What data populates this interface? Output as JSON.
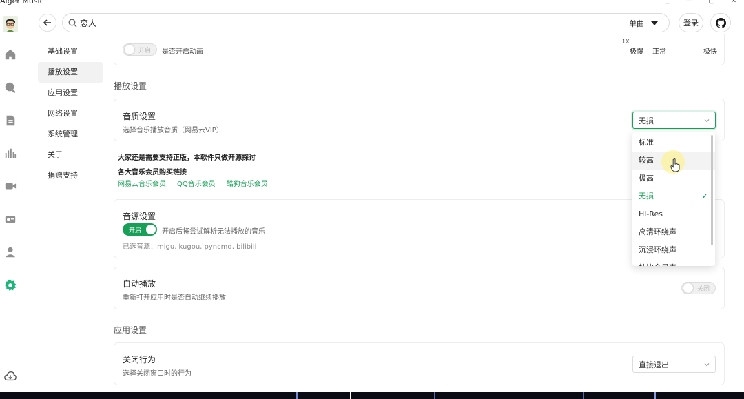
{
  "window": {
    "title": "Aiger Music",
    "controls": [
      "▢",
      "—",
      "▢",
      "✕"
    ]
  },
  "header": {
    "search_value": "恋人",
    "search_type": "单曲",
    "login_label": "登录"
  },
  "rail": {
    "items": [
      "home-icon",
      "search-icon",
      "playlist-icon",
      "chart-icon",
      "video-icon",
      "radio-icon",
      "user-icon",
      "settings-icon",
      "cloud-download-icon"
    ],
    "active": "settings-icon",
    "accent": "#1bb57a"
  },
  "settings_nav": {
    "items": [
      "基础设置",
      "播放设置",
      "应用设置",
      "网络设置",
      "系统管理",
      "关于",
      "捐赠支持"
    ],
    "active_index": 1
  },
  "animation": {
    "toggle_label": "开启",
    "desc": "是否开启动画",
    "speed_tick": "1X",
    "speed_labels": [
      "极慢",
      "正常",
      "极快"
    ]
  },
  "play_section": {
    "heading": "播放设置",
    "quality": {
      "title": "音质设置",
      "subtitle": "选择音乐播放音质（网易云VIP）",
      "selected": "无损",
      "options": [
        "标准",
        "较高",
        "极高",
        "无损",
        "Hi-Res",
        "高清环绕声",
        "沉浸环绕声",
        "杜比全景声"
      ],
      "check": "✓"
    },
    "support_note": {
      "line1": "大家还是需要支持正版，本软件只做开源探讨",
      "line2": "各大音乐会员购买链接",
      "links": [
        "网易云音乐会员",
        "QQ音乐会员",
        "酷狗音乐会员"
      ]
    },
    "source": {
      "title": "音源设置",
      "toggle_label": "开启",
      "desc": "开启后将尝试解析无法播放的音乐",
      "selected_sources": "已选音源：migu, kugou, pyncmd, bilibili"
    },
    "autoplay": {
      "title": "自动播放",
      "subtitle": "重新打开应用时是否自动继续播放",
      "toggle_label": "关闭"
    }
  },
  "app_section": {
    "heading": "应用设置",
    "close_behavior": {
      "title": "关闭行为",
      "subtitle": "选择关闭窗口时的行为",
      "selected": "直接退出"
    }
  },
  "colors": {
    "accent_green": "#18a058",
    "text": "#333333"
  }
}
